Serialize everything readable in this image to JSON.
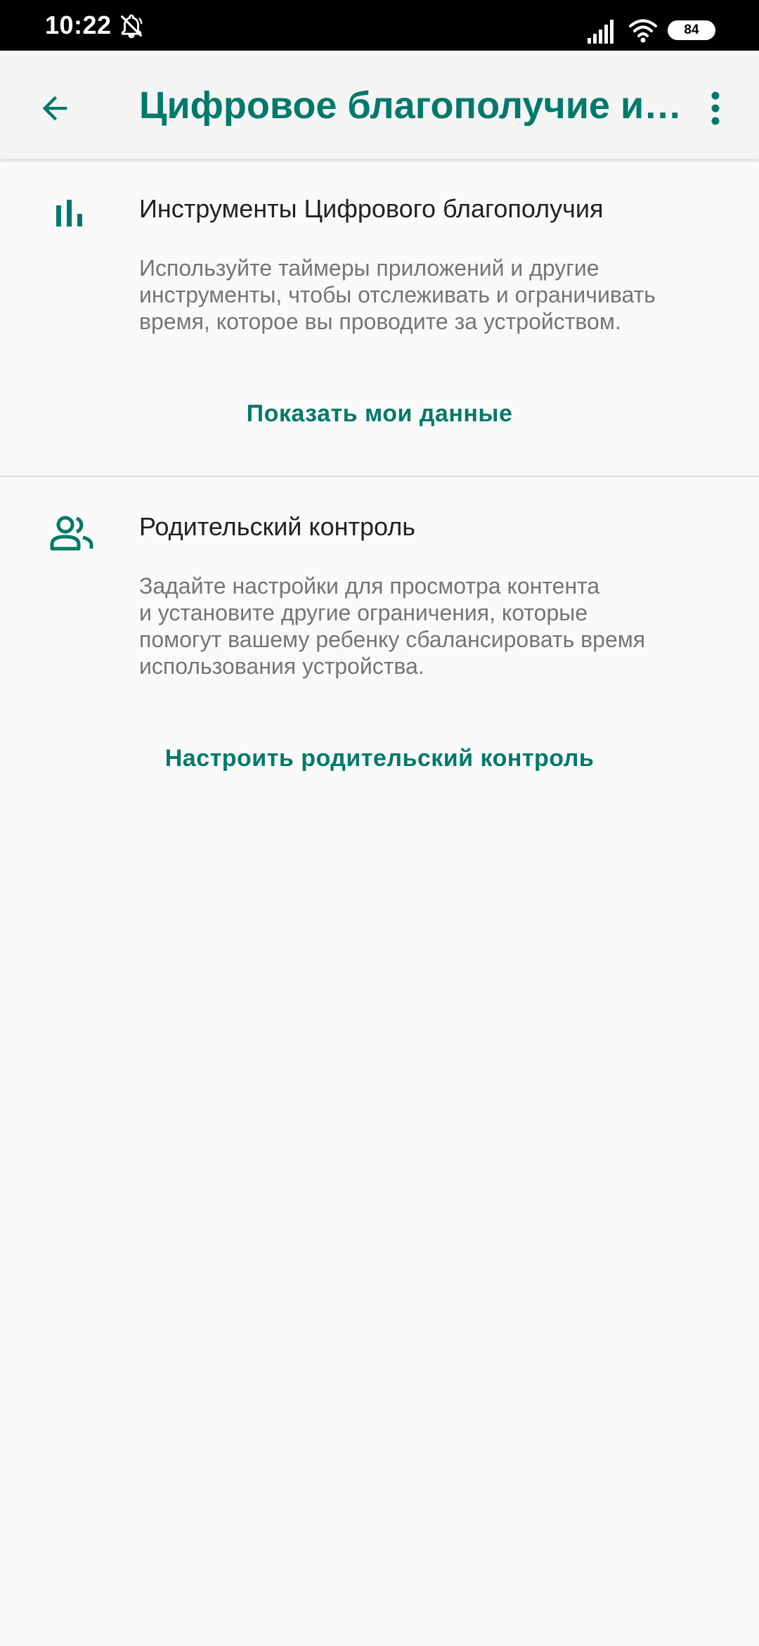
{
  "status_bar": {
    "time": "10:22",
    "battery": "84",
    "icons": [
      "bell-off-icon",
      "signal-icon",
      "wifi-icon",
      "battery-icon"
    ]
  },
  "app_bar": {
    "title": "Цифровое благополучие и…",
    "back_icon": "arrow-back-icon",
    "more_icon": "more-vertical-icon"
  },
  "sections": [
    {
      "icon": "bar-chart-icon",
      "title": "Инструменты Цифрового благополучия",
      "description_lines": [
        "Используйте таймеры приложений и другие",
        "инструменты, чтобы отслеживать и ограничивать",
        "время, которое вы проводите за устройством."
      ],
      "action": "Показать мои данные"
    },
    {
      "icon": "people-icon",
      "title": "Родительский контроль",
      "description_lines": [
        "Задайте настройки для просмотра контента",
        "и установите другие ограничения, которые",
        "помогут вашему ребенку сбалансировать время",
        "использования устройства."
      ],
      "action": "Настроить родительский контроль"
    }
  ],
  "colors": {
    "accent": "#00796b",
    "background": "#fafafa",
    "app_bar": "#f5f5f5",
    "title_text": "#212121",
    "secondary_text": "#757575"
  }
}
